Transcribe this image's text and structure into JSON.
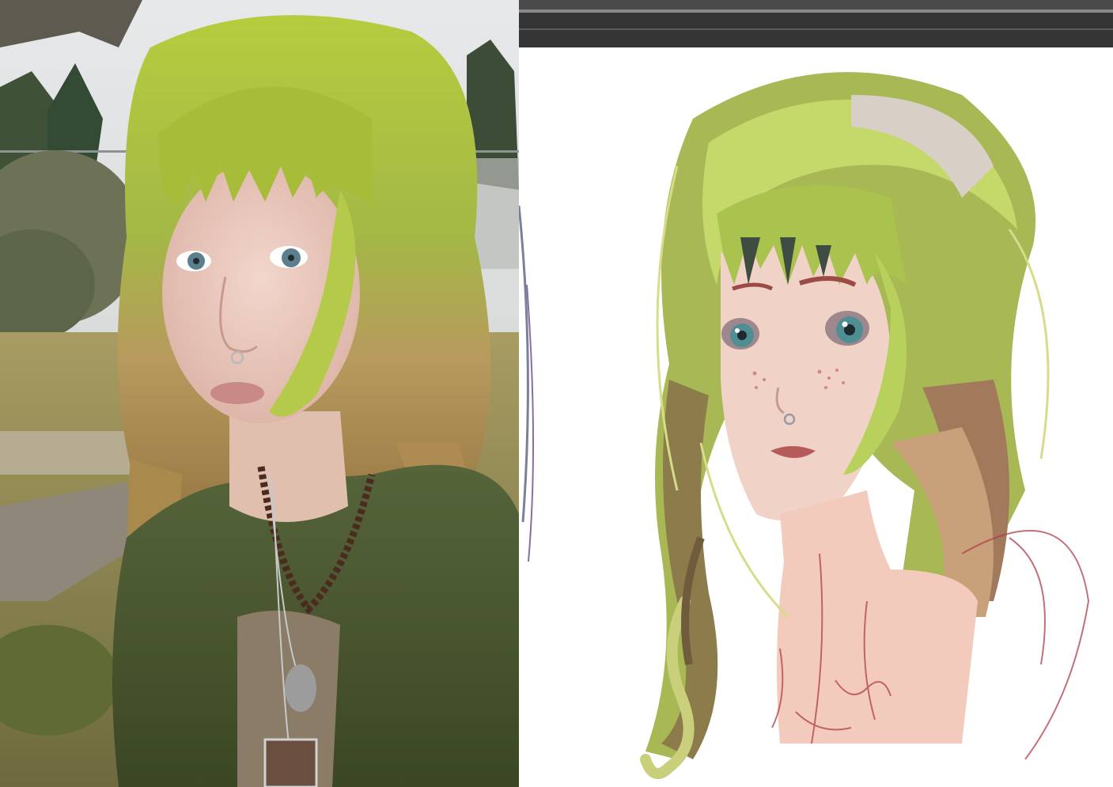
{
  "photo_panel": {
    "subject": "selfie-photo",
    "colors": {
      "hair_green": "#a9c23a",
      "hair_blonde": "#b8925a",
      "cardigan": "#4c5a2c",
      "grass": "#9a8f55",
      "sky": "#dfe2e4"
    }
  },
  "drawing_panel": {
    "subject": "digital-portrait-sketch",
    "colors": {
      "toolbar": "#353535",
      "canvas": "#ffffff",
      "hair_green": "#b9d05a",
      "skin": "#f1cdbf",
      "lips": "#b65a5a",
      "eyes": "#4f8f93",
      "lineart": "#b0404e"
    }
  }
}
